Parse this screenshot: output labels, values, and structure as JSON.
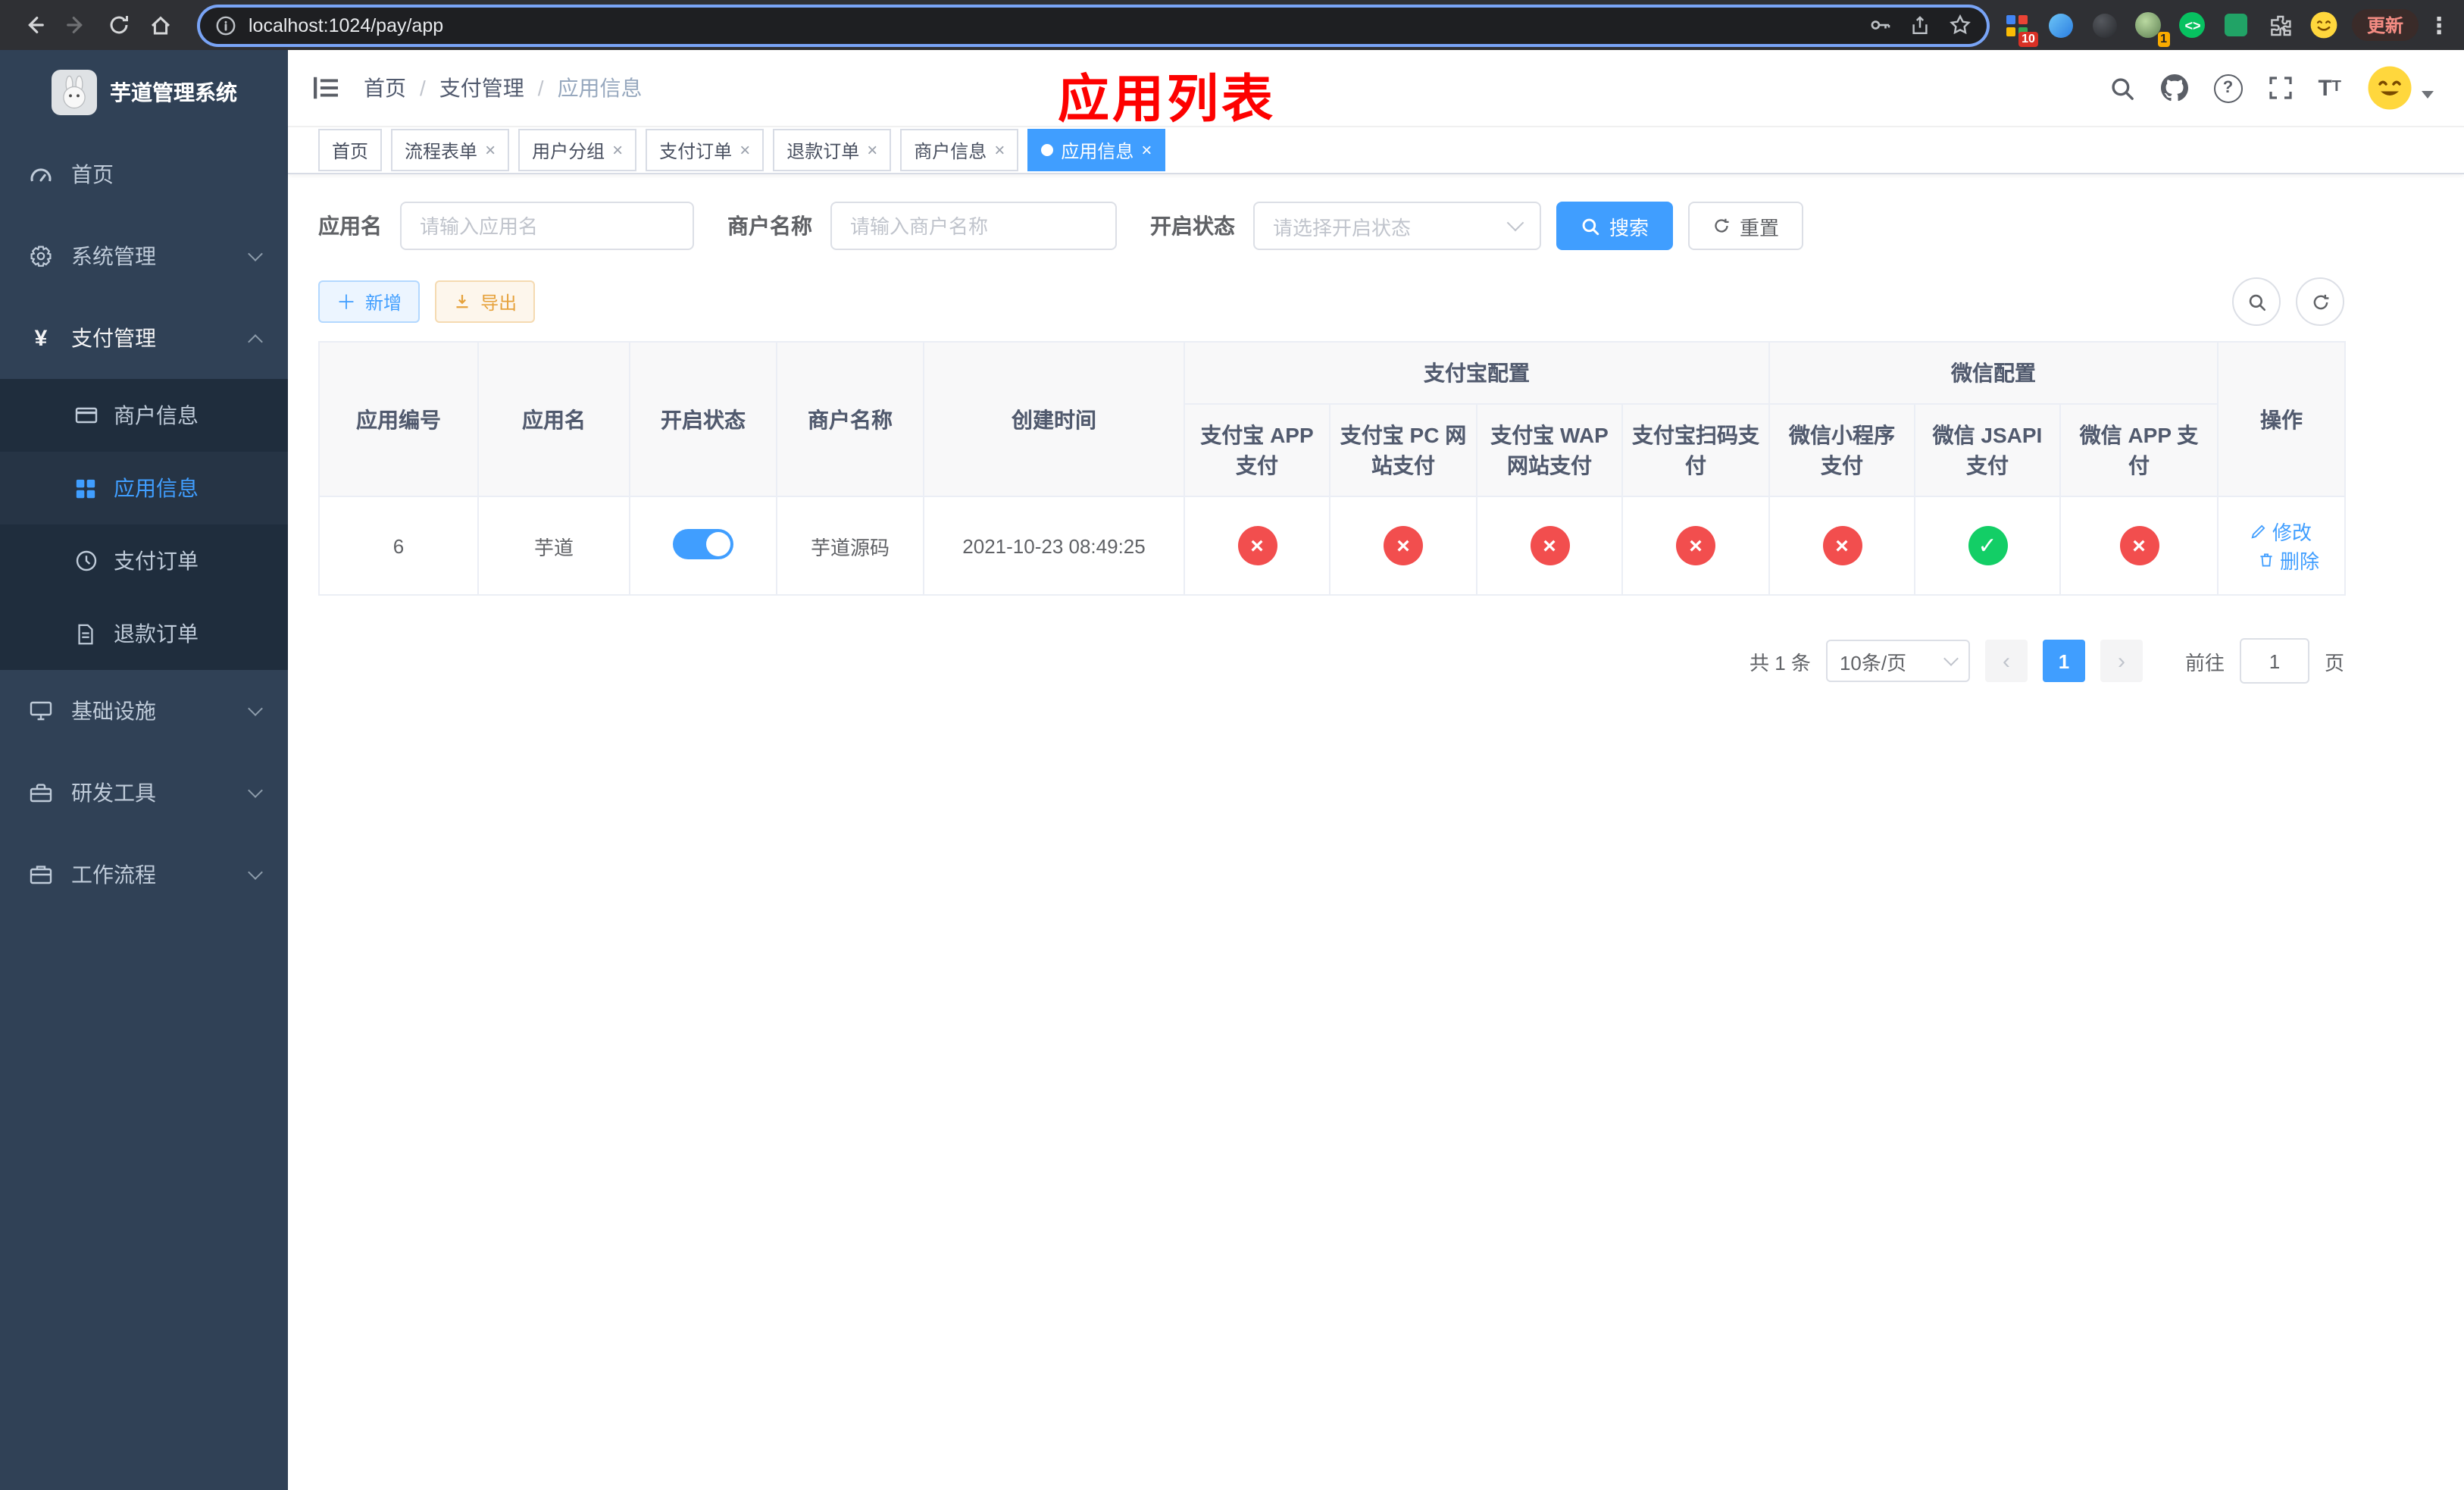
{
  "browser": {
    "url": "localhost:1024/pay/app",
    "update_label": "更新",
    "ext_badge_grid": "10",
    "ext_badge_avatar": "1"
  },
  "colors": {
    "primary": "#409eff",
    "danger": "#f24e4e",
    "success": "#13ce66",
    "warning": "#e6a23c",
    "annotation_red": "#fd0100",
    "sidebar_bg": "#304156",
    "submenu_bg": "#1f2d3d"
  },
  "sidebar": {
    "app_title": "芋道管理系统",
    "menu": [
      {
        "label": "首页"
      },
      {
        "label": "系统管理"
      },
      {
        "label": "支付管理"
      },
      {
        "label": "基础设施"
      },
      {
        "label": "研发工具"
      },
      {
        "label": "工作流程"
      }
    ],
    "payment_submenu": [
      {
        "label": "商户信息"
      },
      {
        "label": "应用信息",
        "active": true
      },
      {
        "label": "支付订单"
      },
      {
        "label": "退款订单"
      }
    ]
  },
  "breadcrumb": [
    "首页",
    "支付管理",
    "应用信息"
  ],
  "page_title": "应用列表",
  "tabs": [
    {
      "label": "首页",
      "closable": false,
      "active": false
    },
    {
      "label": "流程表单",
      "closable": true,
      "active": false
    },
    {
      "label": "用户分组",
      "closable": true,
      "active": false
    },
    {
      "label": "支付订单",
      "closable": true,
      "active": false
    },
    {
      "label": "退款订单",
      "closable": true,
      "active": false
    },
    {
      "label": "商户信息",
      "closable": true,
      "active": false
    },
    {
      "label": "应用信息",
      "closable": true,
      "active": true
    }
  ],
  "filters": {
    "app_name_label": "应用名",
    "app_name_placeholder": "请输入应用名",
    "merchant_label": "商户名称",
    "merchant_placeholder": "请输入商户名称",
    "status_label": "开启状态",
    "status_placeholder": "请选择开启状态",
    "search_label": "搜索",
    "reset_label": "重置"
  },
  "toolbar": {
    "add_label": "新增",
    "export_label": "导出"
  },
  "table": {
    "headers": {
      "app_id": "应用编号",
      "app_name": "应用名",
      "status": "开启状态",
      "merchant": "商户名称",
      "created": "创建时间",
      "alipay_group": "支付宝配置",
      "wechat_group": "微信配置",
      "actions": "操作",
      "alipay_cols": [
        "支付宝 APP 支付",
        "支付宝 PC 网站支付",
        "支付宝 WAP 网站支付",
        "支付宝扫码支付"
      ],
      "wechat_cols": [
        "微信小程序支付",
        "微信 JSAPI 支付",
        "微信 APP 支付"
      ]
    },
    "rows": [
      {
        "app_id": "6",
        "app_name": "芋道",
        "status_on": true,
        "merchant": "芋道源码",
        "created": "2021-10-23 08:49:25",
        "configs": [
          "no",
          "no",
          "no",
          "no",
          "no",
          "yes",
          "no"
        ],
        "edit_label": "修改",
        "delete_label": "删除"
      }
    ]
  },
  "pagination": {
    "total_text": "共 1 条",
    "page_size": "10条/页",
    "current_page": "1",
    "goto_prefix": "前往",
    "goto_value": "1",
    "goto_suffix": "页"
  }
}
